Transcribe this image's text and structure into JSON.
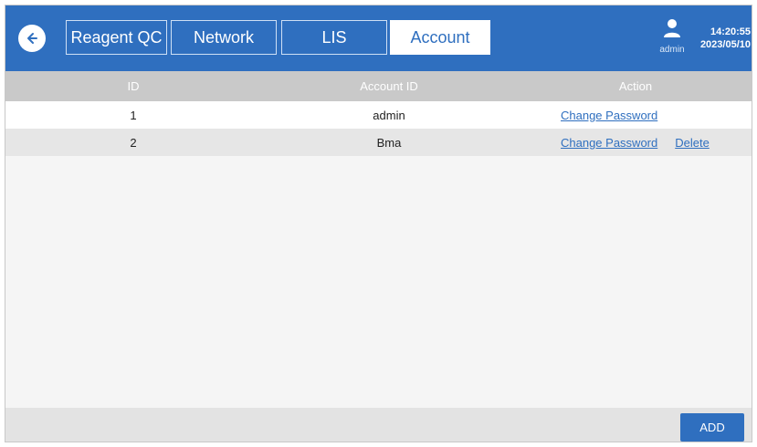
{
  "header": {
    "tabs": [
      {
        "label": "Reagent QC",
        "active": false
      },
      {
        "label": "Network",
        "active": false
      },
      {
        "label": "LIS",
        "active": false
      },
      {
        "label": "Account",
        "active": true
      }
    ],
    "user": "admin",
    "time": "14:20:55",
    "date": "2023/05/10",
    "back_icon": "back-arrow-icon",
    "user_icon": "user-icon"
  },
  "table": {
    "columns": [
      "ID",
      "Account ID",
      "Action"
    ],
    "rows": [
      {
        "id": "1",
        "account": "admin",
        "actions": [
          "Change Password"
        ]
      },
      {
        "id": "2",
        "account": "Bma",
        "actions": [
          "Change Password",
          "Delete"
        ]
      }
    ]
  },
  "footer": {
    "add_label": "ADD"
  },
  "colors": {
    "accent": "#2f6fbf",
    "header_row": "#c9c9c9",
    "alt_row": "#e6e6e6"
  }
}
